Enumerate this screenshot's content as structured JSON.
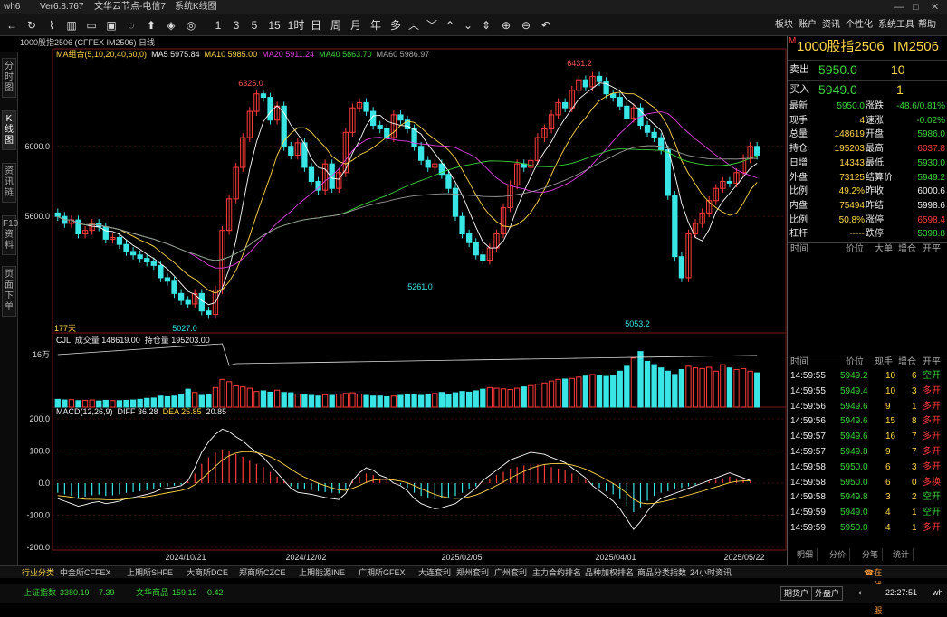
{
  "window": {
    "app": "wh6",
    "version": "Ver6.8.767",
    "server": "文华云节点-电信7",
    "mode": "系统K线图",
    "controls": [
      "—",
      "□",
      "✕"
    ]
  },
  "toolbar": {
    "icons": [
      "back-icon",
      "refresh-icon",
      "time-share-icon",
      "kline-icon",
      "chat-icon",
      "trade-icon",
      "speech-icon",
      "rise-icon",
      "fall-icon",
      "alert-icon",
      "settings-icon",
      "split-icon"
    ],
    "periods": [
      "1",
      "3",
      "5",
      "15",
      "1时",
      "日",
      "周",
      "月",
      "年",
      "多"
    ],
    "nav_icons": [
      "chevron-up-icon",
      "chevron-down-icon",
      "double-up-icon",
      "double-down-icon",
      "expand-icon",
      "zoom-in-icon",
      "zoom-out-icon",
      "undo-icon"
    ],
    "menu": [
      "板块",
      "账户",
      "资讯",
      "个性化",
      "系统工具",
      "帮助"
    ]
  },
  "left_nav": [
    "分时图",
    "K线图",
    "资讯链",
    "F10资料",
    "页面下单"
  ],
  "chart_header": {
    "symbol_line": "1000股指2506 (CFFEX IM2506)  日线",
    "ma_label": "MA组合(5,10,20,40,60,0)",
    "ma5": "MA5 5975.84",
    "ma10": "MA10 5985.00",
    "ma20": "MA20 5911.24",
    "ma40": "MA40 5863.70",
    "ma60": "MA60 5986.97",
    "days": "177天"
  },
  "volume_header": {
    "label": "CJL",
    "volume": "成交量 148619.00",
    "oi": "持仓量 195203.00",
    "axis": "16万"
  },
  "macd_header": {
    "label": "MACD(12,26,9)",
    "diff": "DIFF 36.28",
    "dea": "DEA 25.85",
    "macd": "20.85"
  },
  "chart_data": {
    "type": "candlestick",
    "x_labels": [
      "2024/10/21",
      "2024/12/02",
      "2025/02/05",
      "2025/04/01",
      "2025/05/22"
    ],
    "price_ticks": [
      "6000.0",
      "5600.0"
    ],
    "price_annotations": [
      "6325.0",
      "5027.0",
      "5261.0",
      "6431.2",
      "5053.2"
    ],
    "macd_ticks": [
      "200.0",
      "100.0",
      "0.0",
      "-100.0",
      "-200.0"
    ],
    "ylim_price": [
      4950,
      6500
    ],
    "ylim_macd": [
      -200,
      200
    ],
    "closes": [
      5600,
      5560,
      5580,
      5500,
      5520,
      5560,
      5540,
      5470,
      5480,
      5440,
      5400,
      5380,
      5360,
      5340,
      5320,
      5250,
      5230,
      5160,
      5120,
      5100,
      5160,
      5060,
      5040,
      5180,
      5520,
      5700,
      5880,
      6050,
      6200,
      6300,
      6280,
      6150,
      6230,
      6000,
      5950,
      6020,
      5880,
      5800,
      5750,
      5900,
      5760,
      5850,
      6080,
      6220,
      6250,
      6200,
      6120,
      6100,
      6050,
      6180,
      6150,
      6100,
      6000,
      5920,
      5880,
      5900,
      5840,
      5760,
      5600,
      5500,
      5450,
      5380,
      5350,
      5420,
      5500,
      5650,
      5780,
      5900,
      5880,
      5920,
      6050,
      6100,
      6180,
      6250,
      6220,
      6320,
      6380,
      6340,
      6400,
      6370,
      6300,
      6280,
      6230,
      6160,
      6220,
      6120,
      6080,
      6050,
      5980,
      5720,
      5370,
      5250,
      5500,
      5560,
      5620,
      5690,
      5760,
      5800,
      5790,
      5850,
      5930,
      6000,
      5950
    ],
    "volumes": [
      24,
      22,
      23,
      20,
      21,
      22,
      19,
      21,
      20,
      20,
      21,
      22,
      24,
      27,
      28,
      34,
      32,
      34,
      40,
      55,
      45,
      36,
      40,
      60,
      85,
      78,
      65,
      62,
      58,
      48,
      50,
      46,
      52,
      45,
      44,
      40,
      38,
      36,
      34,
      38,
      36,
      40,
      42,
      44,
      40,
      36,
      34,
      34,
      32,
      34,
      36,
      38,
      40,
      36,
      38,
      42,
      45,
      40,
      44,
      48,
      46,
      50,
      55,
      60,
      58,
      56,
      54,
      58,
      62,
      66,
      70,
      74,
      80,
      85,
      86,
      88,
      92,
      95,
      100,
      96,
      94,
      98,
      110,
      125,
      150,
      170,
      140,
      130,
      120,
      110,
      100,
      115,
      125,
      120,
      118,
      122,
      110,
      130,
      120,
      115,
      118,
      110,
      105
    ],
    "macd": [
      -30,
      -35,
      -40,
      -45,
      -42,
      -38,
      -36,
      -40,
      -38,
      -35,
      -30,
      -28,
      -25,
      -22,
      -18,
      -12,
      -10,
      -8,
      -5,
      5,
      30,
      60,
      80,
      95,
      105,
      100,
      90,
      82,
      70,
      60,
      50,
      35,
      20,
      5,
      -10,
      -18,
      -20,
      -22,
      -25,
      -28,
      -30,
      -32,
      -20,
      5,
      20,
      30,
      25,
      15,
      10,
      0,
      -5,
      -15,
      -30,
      -40,
      -45,
      -50,
      -48,
      -44,
      -40,
      -30,
      -20,
      -10,
      5,
      15,
      25,
      35,
      45,
      50,
      55,
      60,
      58,
      56,
      50,
      45,
      40,
      30,
      20,
      10,
      -5,
      -15,
      -25,
      -35,
      -50,
      -70,
      -90,
      -75,
      -55,
      -40,
      -30,
      -25,
      -20,
      -15,
      -10,
      -5,
      0,
      5,
      10,
      15,
      20,
      15,
      10,
      5
    ]
  },
  "panel": {
    "symbol": "1000股指2506",
    "code": "IM2506",
    "flag": "M",
    "sell_label": "卖出",
    "sell_price": "5950.0",
    "sell_qty": "10",
    "buy_label": "买入",
    "buy_price": "5949.0",
    "buy_qty": "1",
    "quotes": [
      {
        "l1": "最新",
        "v1": "5950.0",
        "l2": "涨跌",
        "v2": "-48.6/0.81%",
        "c1": "green",
        "c2": "green"
      },
      {
        "l1": "现手",
        "v1": "4",
        "l2": "速涨",
        "v2": "-0.02%",
        "c1": "yellow",
        "c2": "green"
      },
      {
        "l1": "总量",
        "v1": "148619",
        "l2": "开盘",
        "v2": "5986.0",
        "c1": "yellow",
        "c2": "green"
      },
      {
        "l1": "持仓",
        "v1": "195203",
        "l2": "最高",
        "v2": "6037.8",
        "c1": "yellow",
        "c2": "red"
      },
      {
        "l1": "日增",
        "v1": "14343",
        "l2": "最低",
        "v2": "5930.0",
        "c1": "yellow",
        "c2": "green"
      },
      {
        "l1": "外盘",
        "v1": "73125",
        "l2": "结算价",
        "v2": "5949.2",
        "c1": "yellow",
        "c2": "green"
      },
      {
        "l1": "比例",
        "v1": "49.2%",
        "l2": "昨收",
        "v2": "6000.6",
        "c1": "yellow",
        "c2": "white"
      },
      {
        "l1": "内盘",
        "v1": "75494",
        "l2": "昨结",
        "v2": "5998.6",
        "c1": "yellow",
        "c2": "white"
      },
      {
        "l1": "比例",
        "v1": "50.8%",
        "l2": "涨停",
        "v2": "6598.4",
        "c1": "yellow",
        "c2": "red"
      },
      {
        "l1": "杠杆",
        "v1": "-----",
        "l2": "跌停",
        "v2": "5398.8",
        "c1": "yellow",
        "c2": "green"
      }
    ],
    "bigtrade_headers": [
      "时间",
      "价位",
      "大单",
      "增仓",
      "开平"
    ],
    "tick_headers": [
      "时间",
      "价位",
      "现手",
      "增仓",
      "开平"
    ],
    "ticks": [
      {
        "t": "14:59:55",
        "p": "5949.2",
        "q": "10",
        "d": "6",
        "k": "空开",
        "kc": "green"
      },
      {
        "t": "14:59:55",
        "p": "5949.4",
        "q": "10",
        "d": "3",
        "k": "多开",
        "kc": "red"
      },
      {
        "t": "14:59:56",
        "p": "5949.6",
        "q": "9",
        "d": "1",
        "k": "多开",
        "kc": "red"
      },
      {
        "t": "14:59:56",
        "p": "5949.6",
        "q": "15",
        "d": "8",
        "k": "多开",
        "kc": "red"
      },
      {
        "t": "14:59:57",
        "p": "5949.6",
        "q": "16",
        "d": "7",
        "k": "多开",
        "kc": "red"
      },
      {
        "t": "14:59:57",
        "p": "5949.8",
        "q": "9",
        "d": "7",
        "k": "多开",
        "kc": "red"
      },
      {
        "t": "14:59:58",
        "p": "5950.0",
        "q": "6",
        "d": "3",
        "k": "多开",
        "kc": "red"
      },
      {
        "t": "14:59:58",
        "p": "5950.0",
        "q": "6",
        "d": "0",
        "k": "多换",
        "kc": "red"
      },
      {
        "t": "14:59:58",
        "p": "5949.8",
        "q": "3",
        "d": "2",
        "k": "空开",
        "kc": "green"
      },
      {
        "t": "14:59:59",
        "p": "5949.0",
        "q": "4",
        "d": "1",
        "k": "空开",
        "kc": "green"
      },
      {
        "t": "14:59:59",
        "p": "5950.0",
        "q": "4",
        "d": "1",
        "k": "多开",
        "kc": "red"
      }
    ],
    "tabs": [
      "明细",
      "分价",
      "分笔",
      "统计"
    ]
  },
  "bottom_tabs": [
    "行业分类",
    "中金所CFFEX",
    "上期所SHFE",
    "大商所DCE",
    "郑商所CZCE",
    "上期能源INE",
    "广期所GFEX",
    "大连套利",
    "郑州套利",
    "广州套利",
    "主力合约排名",
    "品种加权排名",
    "商品分类指数",
    "24小时资讯"
  ],
  "online_service": "在线客服",
  "status": {
    "idx1_label": "上证指数",
    "idx1_value": "3380.19",
    "idx1_chg": "-7.39",
    "idx2_label": "文华商品",
    "idx2_value": "159.12",
    "idx2_chg": "-0.42",
    "account1": "期货户",
    "account2": "外盘户",
    "time": "22:27:51",
    "user": "wh"
  },
  "colors": {
    "up": "#ff3b3b",
    "down": "#39e5e5",
    "ma5": "#ffffff",
    "ma10": "#ffd84a",
    "ma20": "#e040e0",
    "ma40": "#3bd43b",
    "ma60": "#999999"
  }
}
